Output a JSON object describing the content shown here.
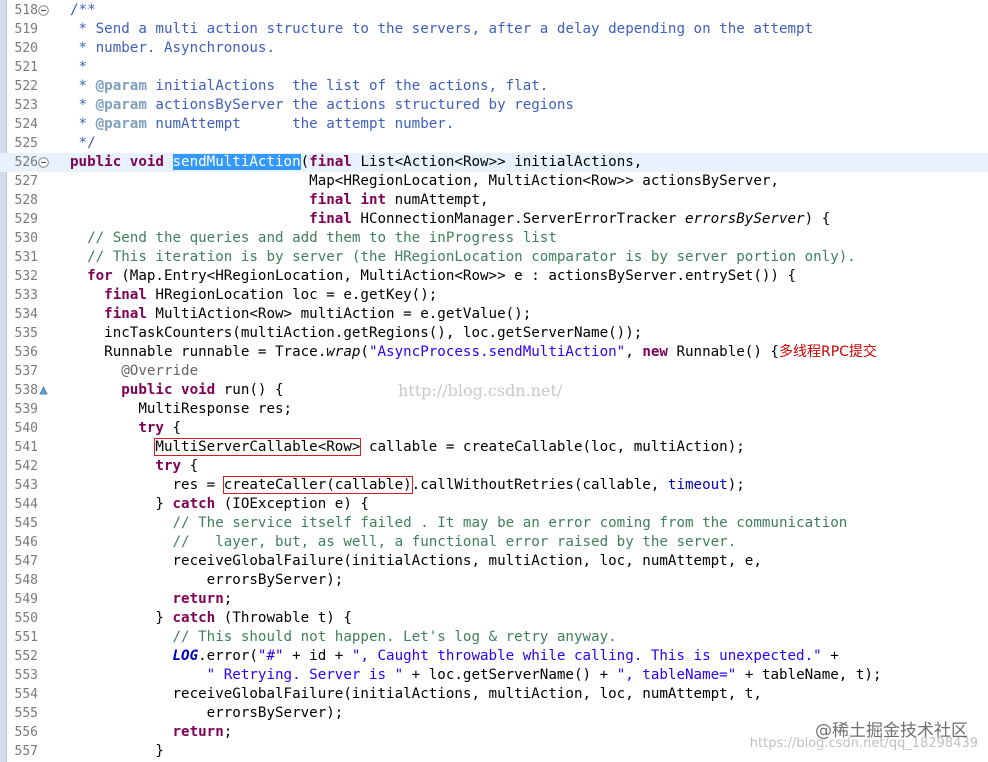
{
  "editor": {
    "colors": {
      "keyword": "#7f0055",
      "comment": "#3f7f5f",
      "javadoc": "#3f5fbf",
      "string": "#2a00ff",
      "field": "#0000c0",
      "selection": "#3399ff",
      "highlight_line": "#e8f2fe",
      "annotation_box": "#cc2222"
    },
    "lines": [
      {
        "n": "518",
        "fold": "minus",
        "t": [
          [
            "jd",
            "/**"
          ]
        ]
      },
      {
        "n": "519",
        "t": [
          [
            "jd",
            " * Send a multi action structure to the servers, after a delay depending on the attempt"
          ]
        ]
      },
      {
        "n": "520",
        "t": [
          [
            "jd",
            " * number. Asynchronous."
          ]
        ]
      },
      {
        "n": "521",
        "t": [
          [
            "jd",
            " *"
          ]
        ]
      },
      {
        "n": "522",
        "t": [
          [
            "jd",
            " * "
          ],
          [
            "tag",
            "@param"
          ],
          [
            "jd",
            " initialActions  the list of the actions, flat."
          ]
        ]
      },
      {
        "n": "523",
        "t": [
          [
            "jd",
            " * "
          ],
          [
            "tag",
            "@param"
          ],
          [
            "jd",
            " actionsByServer the actions structured by regions"
          ]
        ]
      },
      {
        "n": "524",
        "t": [
          [
            "jd",
            " * "
          ],
          [
            "tag",
            "@param"
          ],
          [
            "jd",
            " numAttempt      the attempt number."
          ]
        ]
      },
      {
        "n": "525",
        "t": [
          [
            "jd",
            " */"
          ]
        ]
      },
      {
        "n": "526",
        "fold": "minus",
        "hl": true,
        "t": [
          [
            "kw",
            "public"
          ],
          [
            "",
            " "
          ],
          [
            "kw",
            "void"
          ],
          [
            "",
            " "
          ],
          [
            "sel",
            "sendMultiAction"
          ],
          [
            "",
            "("
          ],
          [
            "kw",
            "final"
          ],
          [
            "",
            " List<Action<Row>> initialActions,"
          ]
        ]
      },
      {
        "n": "527",
        "t": [
          [
            "",
            "                            Map<HRegionLocation, MultiAction<Row>> actionsByServer,"
          ]
        ]
      },
      {
        "n": "528",
        "t": [
          [
            "",
            "                            "
          ],
          [
            "kw",
            "final"
          ],
          [
            "",
            " "
          ],
          [
            "kw",
            "int"
          ],
          [
            "",
            " numAttempt,"
          ]
        ]
      },
      {
        "n": "529",
        "t": [
          [
            "",
            "                            "
          ],
          [
            "kw",
            "final"
          ],
          [
            "",
            " HConnectionManager.ServerErrorTracker "
          ],
          [
            "it",
            "errorsByServer"
          ],
          [
            "",
            ") {"
          ]
        ]
      },
      {
        "n": "530",
        "t": [
          [
            "",
            "  "
          ],
          [
            "cm",
            "// Send the queries and add them to the inProgress list"
          ]
        ]
      },
      {
        "n": "531",
        "t": [
          [
            "",
            "  "
          ],
          [
            "cm",
            "// This iteration is by server (the HRegionLocation comparator is by server portion only)."
          ]
        ]
      },
      {
        "n": "532",
        "t": [
          [
            "",
            "  "
          ],
          [
            "kw",
            "for"
          ],
          [
            "",
            " (Map.Entry<HRegionLocation, MultiAction<Row>> e : actionsByServer.entrySet()) {"
          ]
        ]
      },
      {
        "n": "533",
        "t": [
          [
            "",
            "    "
          ],
          [
            "kw",
            "final"
          ],
          [
            "",
            " HRegionLocation loc = e.getKey();"
          ]
        ]
      },
      {
        "n": "534",
        "t": [
          [
            "",
            "    "
          ],
          [
            "kw",
            "final"
          ],
          [
            "",
            " MultiAction<Row> multiAction = e.getValue();"
          ]
        ]
      },
      {
        "n": "535",
        "t": [
          [
            "",
            "    incTaskCounters(multiAction.getRegions(), loc.getServerName());"
          ]
        ]
      },
      {
        "n": "536",
        "t": [
          [
            "",
            "    Runnable runnable = Trace."
          ],
          [
            "it",
            "wrap"
          ],
          [
            "",
            "("
          ],
          [
            "str",
            "\"AsyncProcess.sendMultiAction\""
          ],
          [
            "",
            ", "
          ],
          [
            "kw",
            "new"
          ],
          [
            "",
            " Runnable() {"
          ],
          [
            "zh",
            "多线程RPC提交"
          ]
        ]
      },
      {
        "n": "537",
        "t": [
          [
            "",
            "      "
          ],
          [
            "ann",
            "@Override"
          ]
        ]
      },
      {
        "n": "538",
        "fold": "marker",
        "t": [
          [
            "",
            "      "
          ],
          [
            "kw",
            "public"
          ],
          [
            "",
            " "
          ],
          [
            "kw",
            "void"
          ],
          [
            "",
            " run() {"
          ]
        ]
      },
      {
        "n": "539",
        "t": [
          [
            "",
            "        MultiResponse res;"
          ]
        ]
      },
      {
        "n": "540",
        "t": [
          [
            "",
            "        "
          ],
          [
            "kw",
            "try"
          ],
          [
            "",
            " {"
          ]
        ]
      },
      {
        "n": "541",
        "t": [
          [
            "",
            "          "
          ],
          [
            "box",
            "MultiServerCallable<Row>"
          ],
          [
            "",
            " callable = createCallable(loc, multiAction);"
          ]
        ]
      },
      {
        "n": "542",
        "t": [
          [
            "",
            "          "
          ],
          [
            "kw",
            "try"
          ],
          [
            "",
            " {"
          ]
        ]
      },
      {
        "n": "543",
        "t": [
          [
            "",
            "            res = "
          ],
          [
            "box",
            "createCaller(callable)"
          ],
          [
            "",
            ".callWithoutRetries(callable, "
          ],
          [
            "fld",
            "timeout"
          ],
          [
            "",
            ");"
          ]
        ]
      },
      {
        "n": "544",
        "t": [
          [
            "",
            "          } "
          ],
          [
            "kw",
            "catch"
          ],
          [
            "",
            " (IOException e) {"
          ]
        ]
      },
      {
        "n": "545",
        "t": [
          [
            "",
            "            "
          ],
          [
            "cm",
            "// The service itself failed . It may be an error coming from the communication"
          ]
        ]
      },
      {
        "n": "546",
        "t": [
          [
            "",
            "            "
          ],
          [
            "cm",
            "//   layer, but, as well, a functional error raised by the server."
          ]
        ]
      },
      {
        "n": "547",
        "t": [
          [
            "",
            "            receiveGlobalFailure(initialActions, multiAction, loc, numAttempt, e,"
          ]
        ]
      },
      {
        "n": "548",
        "t": [
          [
            "",
            "                errorsByServer);"
          ]
        ]
      },
      {
        "n": "549",
        "t": [
          [
            "",
            "            "
          ],
          [
            "kw",
            "return"
          ],
          [
            "",
            ";"
          ]
        ]
      },
      {
        "n": "550",
        "t": [
          [
            "",
            "          } "
          ],
          [
            "kw",
            "catch"
          ],
          [
            "",
            " (Throwable t) {"
          ]
        ]
      },
      {
        "n": "551",
        "t": [
          [
            "",
            "            "
          ],
          [
            "cm",
            "// This should not happen. Let's log & retry anyway."
          ]
        ]
      },
      {
        "n": "552",
        "t": [
          [
            "",
            "            "
          ],
          [
            "sfld",
            "LOG"
          ],
          [
            "",
            ".error("
          ],
          [
            "str",
            "\"#\""
          ],
          [
            "",
            " + id + "
          ],
          [
            "str",
            "\", Caught throwable while calling. This is unexpected.\""
          ],
          [
            "",
            " +"
          ]
        ]
      },
      {
        "n": "553",
        "t": [
          [
            "",
            "                "
          ],
          [
            "str",
            "\" Retrying. Server is \""
          ],
          [
            "",
            " + loc.getServerName() + "
          ],
          [
            "str",
            "\", tableName=\""
          ],
          [
            "",
            " + tableName, t);"
          ]
        ]
      },
      {
        "n": "554",
        "t": [
          [
            "",
            "            receiveGlobalFailure(initialActions, multiAction, loc, numAttempt, t,"
          ]
        ]
      },
      {
        "n": "555",
        "t": [
          [
            "",
            "                errorsByServer);"
          ]
        ]
      },
      {
        "n": "556",
        "t": [
          [
            "",
            "            "
          ],
          [
            "kw",
            "return"
          ],
          [
            "",
            ";"
          ]
        ]
      },
      {
        "n": "557",
        "t": [
          [
            "",
            "          }"
          ]
        ]
      }
    ]
  },
  "watermark": "http://blog.csdn.net/",
  "badge": "@稀土掘金技术社区",
  "url_mark": "https://blog.csdn.net/qq_18298439"
}
